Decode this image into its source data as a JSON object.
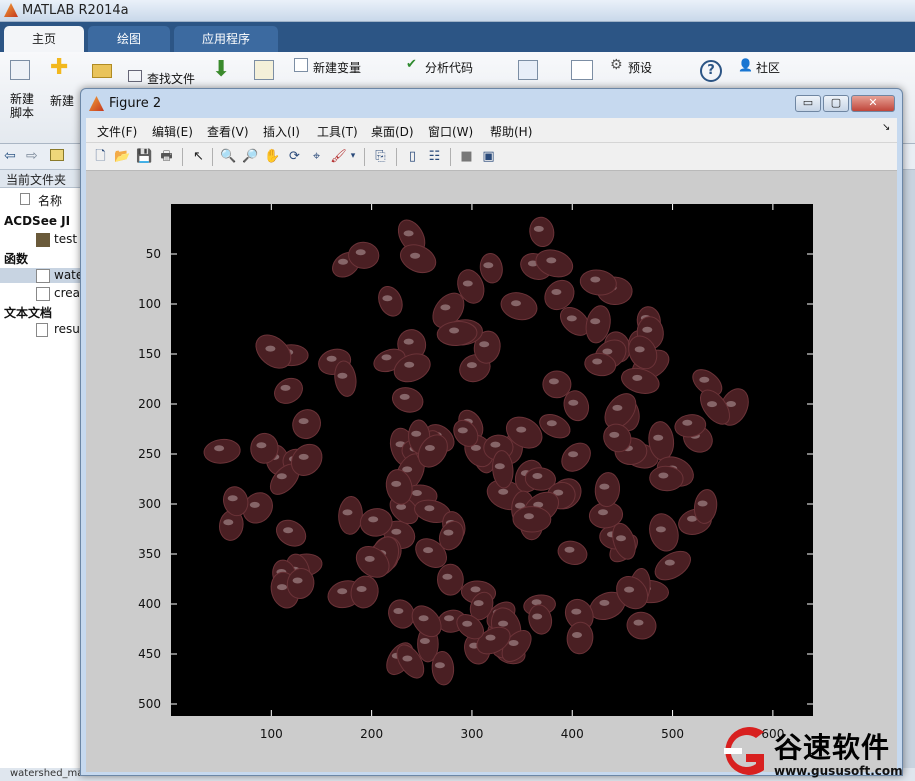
{
  "app": {
    "title": "MATLAB R2014a",
    "tabs": [
      "主页",
      "绘图",
      "应用程序"
    ],
    "ribbon": {
      "new_script": "新建\n脚本",
      "new": "新建",
      "find_files": "查找文件",
      "new_variable": "新建变量",
      "analyze_code": "分析代码",
      "preferences": "预设",
      "community": "社区"
    },
    "current_folder_label": "当前文件夹",
    "files": {
      "name_header": "名称",
      "groups": [
        {
          "label": "ACDSee JI",
          "items": [
            "test"
          ]
        },
        {
          "label": "函数",
          "items": [
            "wate",
            "crea"
          ]
        },
        {
          "label": "文本文档",
          "items": [
            "resu"
          ]
        }
      ]
    },
    "status_text": "watershed_main..."
  },
  "figure": {
    "title": "Figure 2",
    "menus": [
      "文件(F)",
      "编辑(E)",
      "查看(V)",
      "插入(I)",
      "工具(T)",
      "桌面(D)",
      "窗口(W)",
      "帮助(H)"
    ],
    "window_buttons": {
      "minimize": "▭",
      "maximize": "▢",
      "close": "✕"
    }
  },
  "chart_data": {
    "type": "image",
    "x_ticks": [
      100,
      200,
      300,
      400,
      500,
      600
    ],
    "y_ticks": [
      50,
      100,
      150,
      200,
      250,
      300,
      350,
      400,
      450,
      500
    ],
    "xlim": [
      0,
      640
    ],
    "ylim": [
      0,
      512
    ],
    "background": "#000000",
    "bean_color": "#4a1f23"
  },
  "watermark": {
    "name": "谷速软件",
    "url": "www.gususoft.com"
  }
}
